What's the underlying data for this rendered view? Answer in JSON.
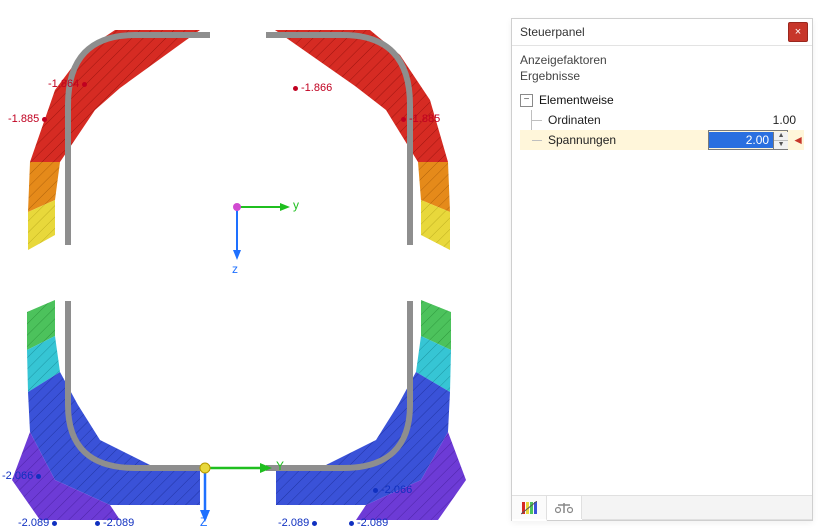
{
  "panel": {
    "title": "Steuerpanel",
    "sections": {
      "anzeigefaktoren": "Anzeigefaktoren",
      "ergebnisse": "Ergebnisse"
    },
    "tree": {
      "elementweise": "Elementweise",
      "toggle_glyph": "−",
      "ordinaten_label": "Ordinaten",
      "ordinaten_value": "1.00",
      "spannungen_label": "Spannungen",
      "spannungen_value": "2.00"
    },
    "close_glyph": "×",
    "step_up": "▲",
    "step_down": "▼",
    "active_arrow": "◄"
  },
  "viewer": {
    "labels": {
      "tl": "-1.864",
      "tr": "-1.866",
      "ml": "-1.885",
      "mr": "-1.885",
      "bl1": "-2.066",
      "bl2": "-2.089",
      "bl3": "-2.089",
      "br1": "-2.066",
      "br2": "-2.089",
      "br3": "-2.089"
    },
    "axes": {
      "y_small": "y",
      "z_small": "z",
      "Y_big": "Y",
      "Z_big": "Z"
    }
  }
}
